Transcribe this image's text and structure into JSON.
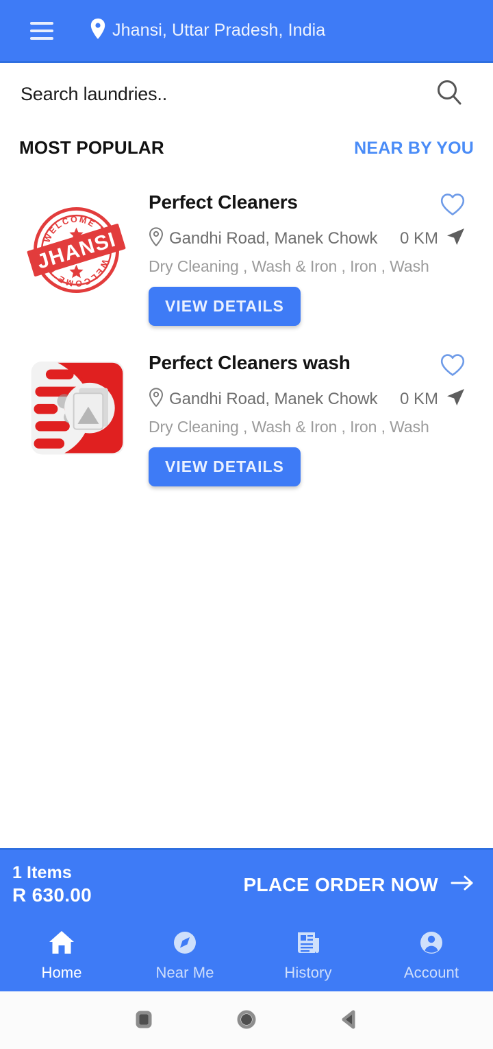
{
  "appbar": {
    "menu_icon": "hamburger-menu-icon",
    "location_icon": "map-pin-icon",
    "location": "Jhansi, Uttar Pradesh, India"
  },
  "search": {
    "value": "",
    "placeholder": "Search laundries..",
    "icon": "search-icon"
  },
  "section": {
    "title": "MOST POPULAR",
    "link": "NEAR BY YOU"
  },
  "listings": [
    {
      "name": "Perfect Cleaners",
      "address": "Gandhi Road, Manek Chowk",
      "distance": "0 KM",
      "services": "Dry Cleaning , Wash & Iron , Iron , Wash",
      "button": "VIEW DETAILS",
      "logo_alt": "WELCOME TO JHANSI",
      "logo_text_top": "WELCOME TO",
      "logo_text_mid": "JHANSI",
      "logo_text_bottom": "WELCOME TO",
      "favorite_icon": "heart-outline-icon",
      "navigate_icon": "navigation-arrow-icon",
      "address_icon": "map-pin-outline-icon"
    },
    {
      "name": "Perfect Cleaners wash",
      "address": "Gandhi Road, Manek Chowk",
      "distance": "0 KM",
      "services": "Dry Cleaning , Wash & Iron , Iron , Wash",
      "button": "VIEW DETAILS",
      "logo_alt": "Red motion-lines laundry logo",
      "favorite_icon": "heart-outline-icon",
      "navigate_icon": "navigation-arrow-icon",
      "address_icon": "map-pin-outline-icon"
    }
  ],
  "order_bar": {
    "items": "1 Items",
    "total": "R 630.00",
    "cta": "PLACE ORDER NOW",
    "cta_icon": "arrow-right-icon"
  },
  "bottom_nav": {
    "items": [
      {
        "label": "Home",
        "icon": "home-icon",
        "active": true
      },
      {
        "label": "Near Me",
        "icon": "compass-icon",
        "active": false
      },
      {
        "label": "History",
        "icon": "newspaper-icon",
        "active": false
      },
      {
        "label": "Account",
        "icon": "person-icon",
        "active": false
      }
    ]
  },
  "system_bar": {
    "recents": "square-recents-button",
    "home": "circle-home-button",
    "back": "triangle-back-button"
  },
  "colors": {
    "brand_blue": "#3E7BF6",
    "link_blue": "#4A8CF7",
    "heart_blue": "#6E9BE8",
    "logo_red": "#E02020",
    "text_dark": "#141414",
    "text_muted": "#6E6E6E",
    "text_light": "#9B9B9B"
  }
}
